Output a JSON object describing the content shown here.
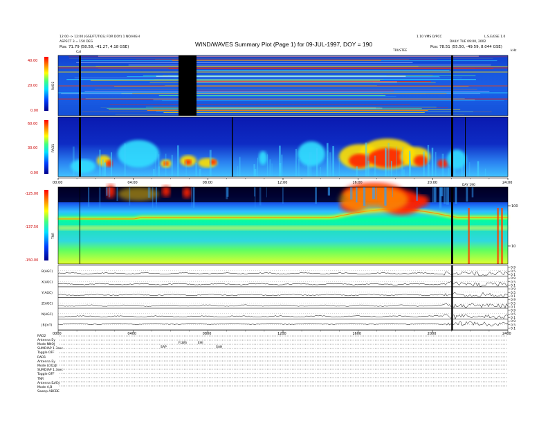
{
  "header": {
    "title": "WIND/WAVES Summary Plot (Page 1) for 09-JUL-1997, DOY = 190",
    "left_line1": "12:00 -> 12:00 (GSE/FT/TIGS; FOR DOY) 1 NO/HIGH",
    "left_line2": "ASPECT 3 = 150 DEG",
    "left_pos": "Pos:     71.79 (58.58, -41.27, 4.18 GSE)",
    "right_line1": "L.S.E/GSE 1.0",
    "mid_right": "1.10 VMS D/PCC",
    "right_date": "DAILY: TUE 09:00, 2002",
    "right_pos": "Pos:     78.51 (55.50, -49.59, 8.044 GSE)",
    "cal_label": "Cal",
    "trustee_label": "TRUSTEE",
    "khz_label": "kHz"
  },
  "colors": {
    "low": "#0000a0",
    "mid": "#00c8ff",
    "hi": "#ffff00",
    "peak": "#ff0000",
    "black": "#000000"
  },
  "chart_data": [
    {
      "type": "heatmap",
      "panel": "RAD2",
      "ylabel": "RAD2",
      "yticks": [
        "40.00",
        "20.00",
        "0.00"
      ]
    },
    {
      "type": "heatmap",
      "panel": "RAD1",
      "ylabel": "RAD1",
      "yticks": [
        "60.00",
        "30.00",
        "0.00"
      ],
      "xticks": [
        "00:00",
        "04:00",
        "08:00",
        "12:00",
        "16:00",
        "20:00",
        "24:00"
      ],
      "xnote": "DAY 190"
    },
    {
      "type": "heatmap",
      "panel": "TNR",
      "ylabel": "TNR",
      "yticks": [
        "-125.00",
        "-137.50",
        "-150.00"
      ],
      "right_ticks": [
        "100",
        "10"
      ]
    },
    {
      "type": "line",
      "panel": "magnetometer",
      "series": [
        {
          "name": "B(AGC)"
        },
        {
          "name": "X(AGC)"
        },
        {
          "name": "Y(AGC)"
        },
        {
          "name": "Z(AGC)"
        },
        {
          "name": "N(AGC)"
        },
        {
          "name": "|B|(nT)"
        }
      ],
      "right_ticks": [
        "0.9",
        "0.5",
        "0.1"
      ],
      "xticks": [
        "0000",
        "0400",
        "0800",
        "1200",
        "1600",
        "2000",
        "2400"
      ]
    }
  ],
  "footer": {
    "rad2": {
      "head": "RAD2",
      "rows": [
        "Antenna    Ey",
        "Mode    NNOJ",
        "SUMDIAP  1.3sec",
        "Toggle    OFF"
      ]
    },
    "rad1": {
      "head": "RAD1",
      "rows": [
        "Antenna    Ey",
        "Mode   LOQ2JI",
        "SUMDIAP  1.3sec",
        "Toggle    OFF"
      ]
    },
    "tnr": {
      "head": "TNR",
      "rows": [
        "Antenna   Ez/Ey",
        "Mode      A,B",
        "Sweep    ABCDE"
      ]
    },
    "annots": [
      "SAP",
      "FLWS",
      "EHI",
      "SAH"
    ]
  }
}
